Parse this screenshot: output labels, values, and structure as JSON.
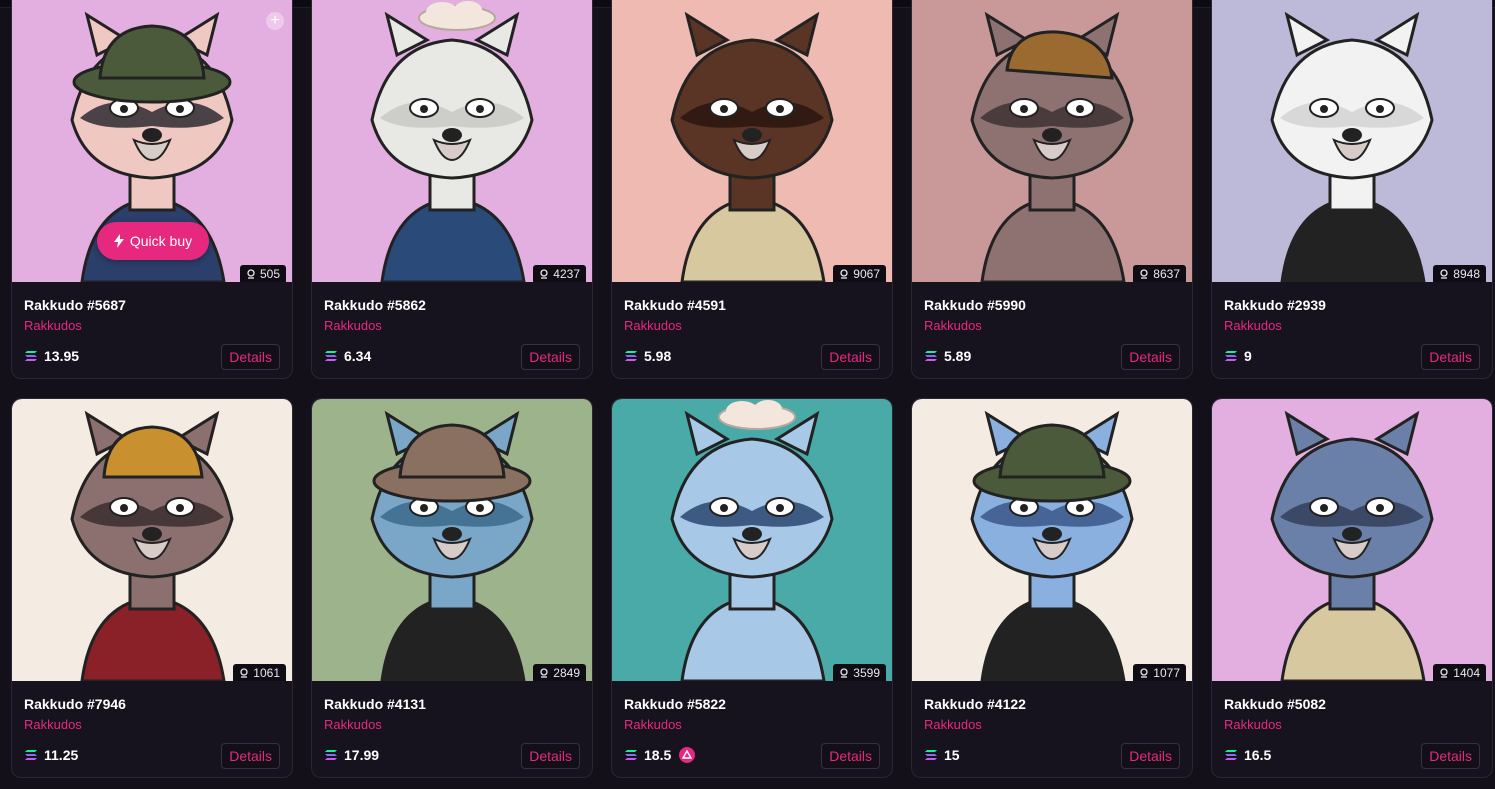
{
  "quick_buy_label": "Quick buy",
  "details_label": "Details",
  "accent_color": "#e6297e",
  "cards": [
    {
      "name": "Rakkudo #5687",
      "collection": "Rakkudos",
      "price": "13.95",
      "rank": "505",
      "bg": "#e3aee0",
      "fur": "#f0c8c2",
      "dark": "#2d2a30",
      "accessory": "bucket-hat-pattern",
      "clothing": "#2c3e6b"
    },
    {
      "name": "Rakkudo #5862",
      "collection": "Rakkudos",
      "price": "6.34",
      "rank": "4237",
      "bg": "#e3aee0",
      "fur": "#e8e8e4",
      "dark": "#c8c8c4",
      "accessory": "cloud",
      "clothing": "#2a4a7a"
    },
    {
      "name": "Rakkudo #4591",
      "collection": "Rakkudos",
      "price": "5.98",
      "rank": "9067",
      "bg": "#efbab2",
      "fur": "#5a3424",
      "dark": "#2a160e",
      "accessory": "none",
      "clothing": "#d8c8a0"
    },
    {
      "name": "Rakkudo #5990",
      "collection": "Rakkudos",
      "price": "5.89",
      "rank": "8637",
      "bg": "#c9999a",
      "fur": "#8e7272",
      "dark": "#3e3232",
      "accessory": "cap",
      "clothing": "#8e7272"
    },
    {
      "name": "Rakkudo #2939",
      "collection": "Rakkudos",
      "price": "9",
      "rank": "8948",
      "bg": "#bcbad8",
      "fur": "#f2f2f2",
      "dark": "#d4d4d4",
      "accessory": "none",
      "clothing": "#222222"
    },
    {
      "name": "Rakkudo #7946",
      "collection": "Rakkudos",
      "price": "11.25",
      "rank": "1061",
      "bg": "#f4ece2",
      "fur": "#8c7070",
      "dark": "#3a2e2e",
      "accessory": "beanie",
      "clothing": "#8a2028"
    },
    {
      "name": "Rakkudo #4131",
      "collection": "Rakkudos",
      "price": "17.99",
      "rank": "2849",
      "bg": "#9db38b",
      "fur": "#7aa6c8",
      "dark": "#3c6a8a",
      "accessory": "bucket-hat",
      "clothing": "#222222"
    },
    {
      "name": "Rakkudo #5822",
      "collection": "Rakkudos",
      "price": "18.5",
      "rank": "3599",
      "bg": "#4aaaa8",
      "fur": "#a8c8e8",
      "dark": "#2a4870",
      "accessory": "cloud",
      "clothing": "#a8c8e8",
      "badge": true
    },
    {
      "name": "Rakkudo #4122",
      "collection": "Rakkudos",
      "price": "15",
      "rank": "1077",
      "bg": "#f4ece2",
      "fur": "#8ab0e0",
      "dark": "#3a5888",
      "accessory": "bucket-hat-pattern",
      "clothing": "#222222"
    },
    {
      "name": "Rakkudo #5082",
      "collection": "Rakkudos",
      "price": "16.5",
      "rank": "1404",
      "bg": "#e3aee0",
      "fur": "#6a80a8",
      "dark": "#34405a",
      "accessory": "none",
      "clothing": "#d8c8a0"
    }
  ]
}
